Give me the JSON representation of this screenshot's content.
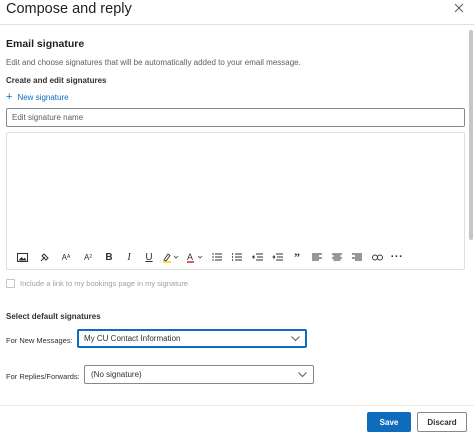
{
  "dialog": {
    "title": "Compose and reply",
    "close_icon": "close-icon"
  },
  "email_signature": {
    "title": "Email signature",
    "description": "Edit and choose signatures that will be automatically added to your email message.",
    "create_edit_heading": "Create and edit signatures",
    "new_signature_label": "New signature",
    "signature_name_placeholder": "Edit signature name",
    "signature_name_value": "",
    "editor_content": "",
    "toolbar": [
      {
        "name": "insert-picture-icon"
      },
      {
        "name": "format-painter-icon"
      },
      {
        "name": "font-size-decrease-icon"
      },
      {
        "name": "font-size-increase-icon"
      },
      {
        "name": "bold-icon"
      },
      {
        "name": "italic-icon"
      },
      {
        "name": "underline-icon"
      },
      {
        "name": "highlight-icon"
      },
      {
        "name": "font-color-icon"
      },
      {
        "name": "bullets-icon"
      },
      {
        "name": "numbering-icon"
      },
      {
        "name": "decrease-indent-icon"
      },
      {
        "name": "increase-indent-icon"
      },
      {
        "name": "quote-icon"
      },
      {
        "name": "align-left-icon"
      },
      {
        "name": "align-center-icon"
      },
      {
        "name": "align-right-icon"
      },
      {
        "name": "link-icon"
      },
      {
        "name": "more-options-icon"
      }
    ],
    "bookings_checkbox_label": "Include a link to my bookings page in my signature",
    "bookings_checked": false
  },
  "defaults": {
    "title": "Select default signatures",
    "new_messages_label": "For New Messages:",
    "new_messages_value": "My CU Contact Information",
    "replies_label": "For Replies/Forwards:",
    "replies_value": "(No signature)"
  },
  "footer": {
    "save_label": "Save",
    "discard_label": "Discard"
  },
  "colors": {
    "accent": "#0f6cbd",
    "highlight_yellow": "#ffd700",
    "font_color_red": "#d13438"
  }
}
